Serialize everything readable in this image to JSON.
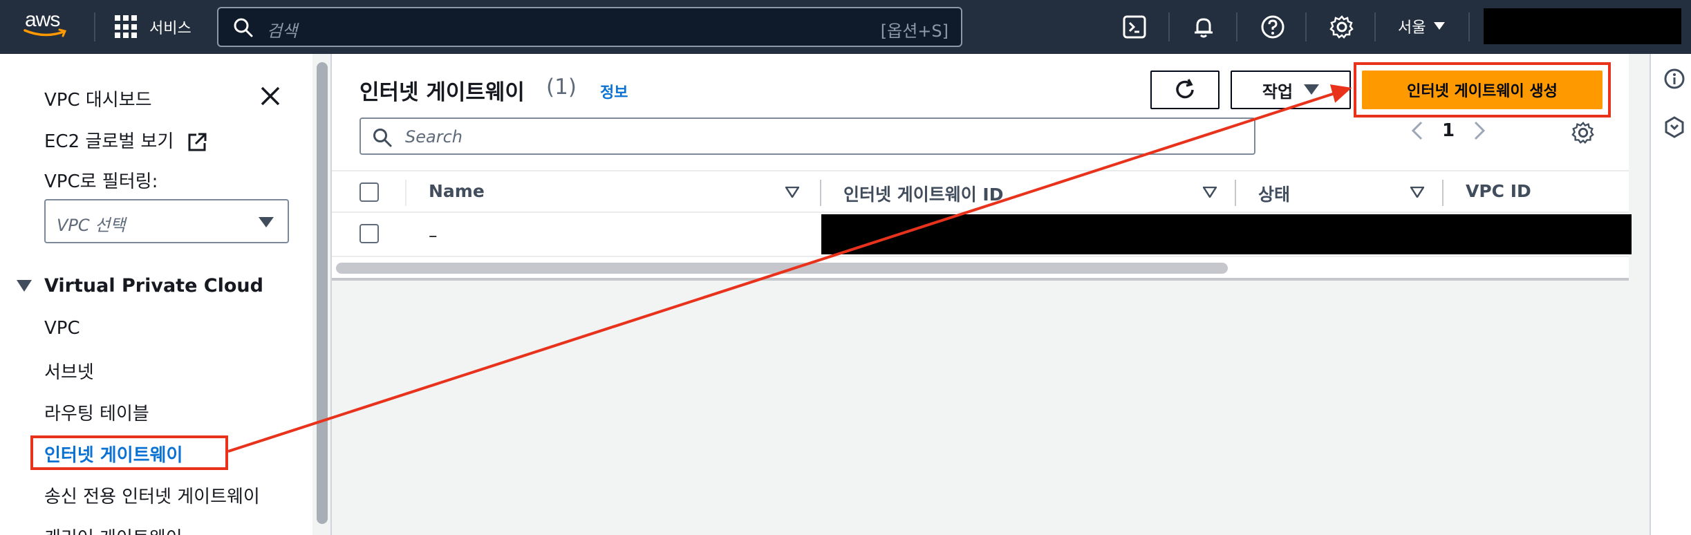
{
  "topnav": {
    "logo_text": "aws",
    "services_label": "서비스",
    "search_placeholder": "검색",
    "search_shortcut": "[옵션+S]",
    "region_label": "서울",
    "icons": [
      "cloudshell-icon",
      "bell-icon",
      "help-icon",
      "gear-icon"
    ]
  },
  "sidebar": {
    "dashboard": "VPC 대시보드",
    "global_view": "EC2 글로벌 보기",
    "filter_label": "VPC로 필터링:",
    "filter_placeholder": "VPC 선택",
    "section_title": "Virtual Private Cloud",
    "items": [
      {
        "label": "VPC"
      },
      {
        "label": "서브넷"
      },
      {
        "label": "라우팅 테이블"
      },
      {
        "label": "인터넷 게이트웨이",
        "active": true
      },
      {
        "label": "송신 전용 인터넷 게이트웨이"
      },
      {
        "label": "캐리어 게이트웨이"
      }
    ]
  },
  "main": {
    "title": "인터넷 게이트웨이",
    "count": "(1)",
    "info_link": "정보",
    "actions_label": "작업",
    "create_button": "인터넷 게이트웨이 생성",
    "search_placeholder": "Search",
    "page_number": "1",
    "columns": [
      "Name",
      "인터넷 게이트웨이 ID",
      "상태",
      "VPC ID"
    ],
    "rows": [
      {
        "name": "–"
      }
    ]
  },
  "colors": {
    "nav_bg": "#232f3e",
    "primary": "#ff9900",
    "link": "#0972d3",
    "annotation": "#e8321b"
  }
}
